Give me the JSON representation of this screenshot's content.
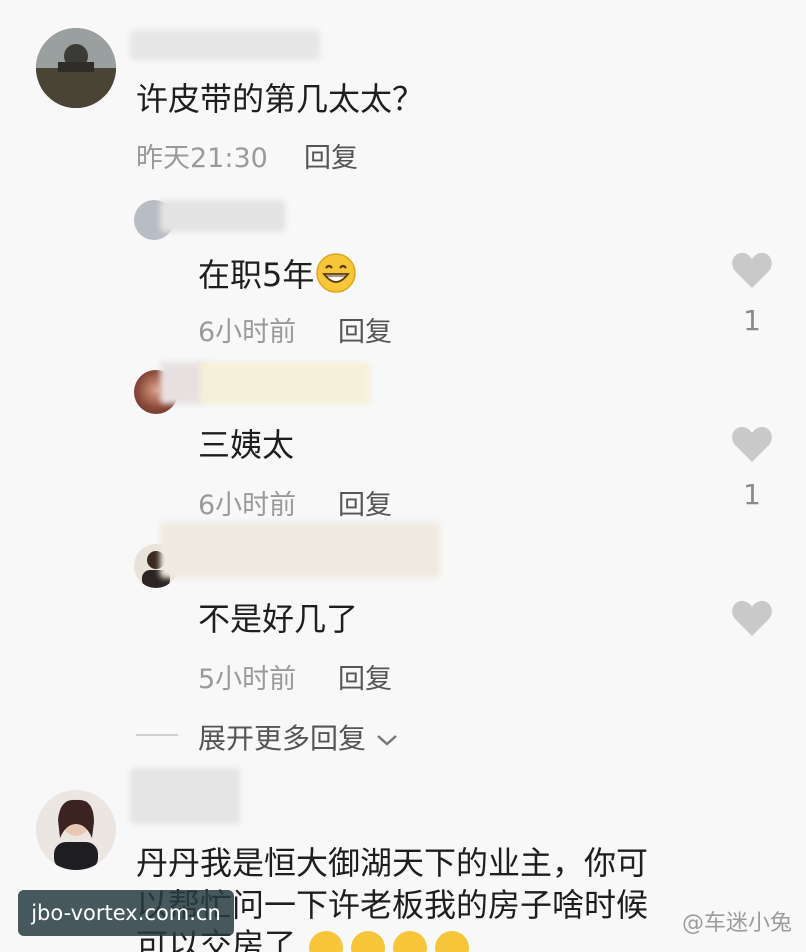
{
  "comments": [
    {
      "text": "许皮带的第几太太？",
      "time": "昨天21:30",
      "reply_label": "回复"
    }
  ],
  "replies": [
    {
      "text": "在职5年",
      "emoji": "grinning-face",
      "time": "6小时前",
      "reply_label": "回复",
      "like_count": "1"
    },
    {
      "text": "三姨太",
      "time": "6小时前",
      "reply_label": "回复",
      "like_count": "1"
    },
    {
      "text": "不是好几了",
      "time": "5小时前",
      "reply_label": "回复",
      "like_count": ""
    }
  ],
  "expand_label": "展开更多回复",
  "second_comment": {
    "text_line1": "丹丹我是恒大御湖天下的业主，你可",
    "text_line2": "以帮忙问一下许老板我的房子啥时候",
    "text_line3": "可以交房了"
  },
  "watermarks": {
    "left": "jbo-vortex.com.cn",
    "right": "@车迷小兔"
  },
  "colors": {
    "background": "#f8f8f8",
    "heart": "#c9c9c9",
    "meta_text": "#9a9a9a"
  }
}
